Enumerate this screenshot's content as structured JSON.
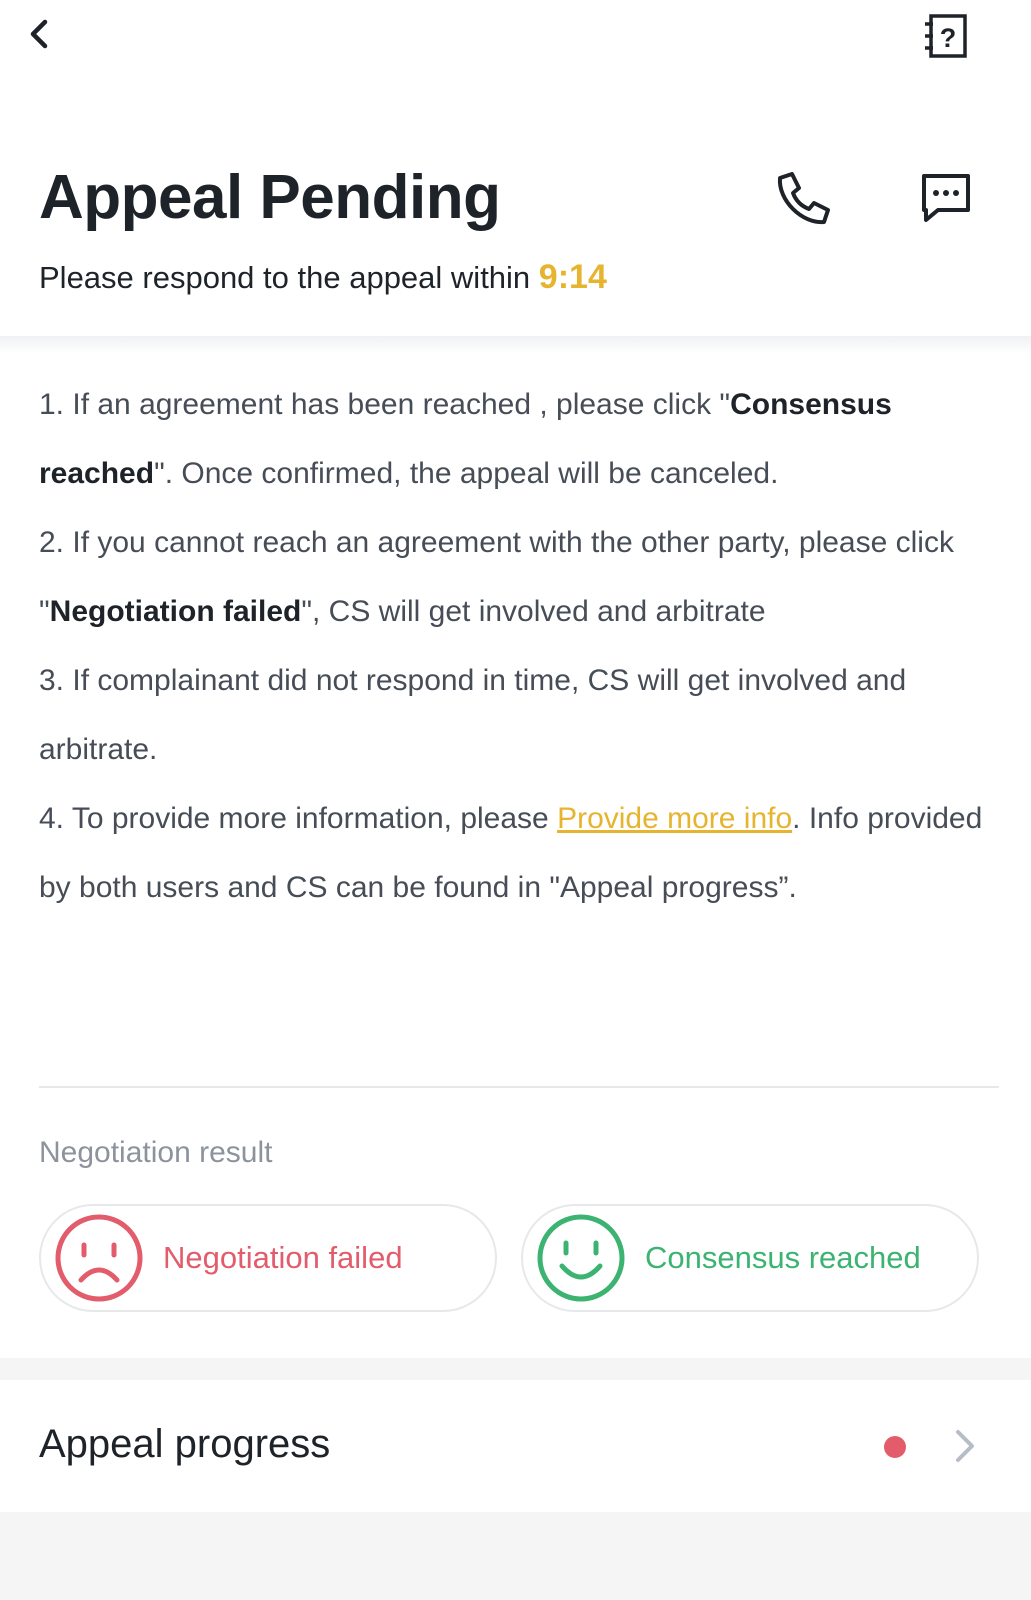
{
  "nav": {
    "back_icon": "chevron-left-icon",
    "help_icon": "question-book-icon"
  },
  "header": {
    "title": "Appeal Pending",
    "subtitle_prefix": "Please respond to the appeal within ",
    "timer": "9:14",
    "call_icon": "phone-icon",
    "chat_icon": "chat-bubble-icon"
  },
  "instructions": {
    "item1_pre": "1. If an agreement has been reached , please click \"",
    "item1_bold": "Consensus reached",
    "item1_post": "\". Once confirmed, the appeal will be canceled.",
    "item2_pre": "2. If you cannot reach an agreement with the other party, please click \"",
    "item2_bold": "Negotiation failed",
    "item2_post": "\", CS will get involved and arbitrate",
    "item3": "3. If complainant did not respond in time, CS will get involved and arbitrate.",
    "item4_pre": "4. To provide more information, please ",
    "item4_link": "Provide more info",
    "item4_post": ". Info provided by both users and CS can be found in \"Appeal progress”."
  },
  "negotiation": {
    "label": "Negotiation result",
    "failed_label": "Negotiation failed",
    "reached_label": "Consensus reached",
    "failed_icon": "sad-face-icon",
    "reached_icon": "happy-face-icon"
  },
  "progress": {
    "label": "Appeal progress",
    "has_notification": true
  },
  "colors": {
    "accent": "#e6b42e",
    "failed": "#e25c6b",
    "success": "#3cb371",
    "text": "#1e2329",
    "muted": "#8c939c"
  }
}
